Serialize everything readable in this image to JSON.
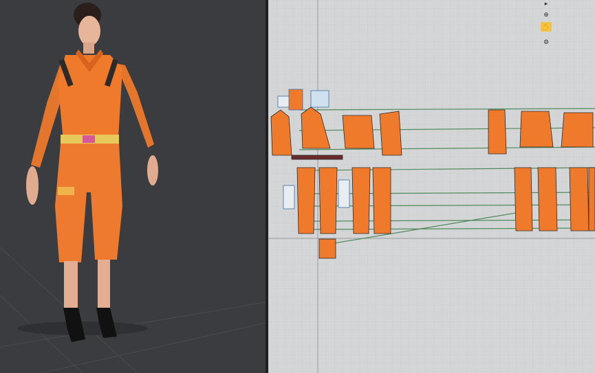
{
  "app": {
    "panels": {
      "viewport_3d": "3d-avatar-viewport",
      "pattern_2d": "2d-pattern-window"
    }
  },
  "toolbar2d": {
    "tools": [
      {
        "name": "select-tool-icon"
      },
      {
        "name": "zoom-tool-icon"
      },
      {
        "name": "hand-pan-tool-icon"
      },
      {
        "name": "settings-tool-icon"
      }
    ],
    "active_index": 2
  },
  "colors": {
    "garment_orange": "#f07a2c",
    "outline_dark": "#2a2a2a",
    "seam_green": "#4f8a5c",
    "seam_blue": "#3c6ea8",
    "viewport_bg": "#3b3c3f",
    "pattern_bg": "#d4d5d6"
  }
}
